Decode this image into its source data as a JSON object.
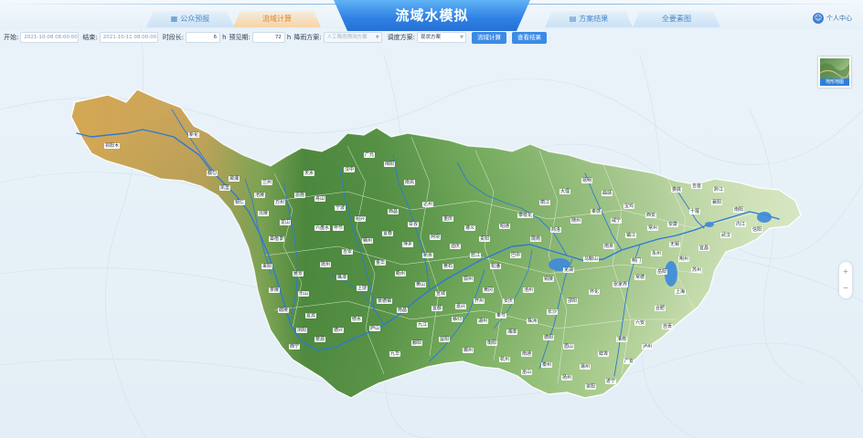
{
  "header": {
    "title": "流域水模拟",
    "tabs": [
      {
        "label": "公众预报",
        "icon": "grid-icon"
      },
      {
        "label": "流域计算",
        "icon": ""
      },
      {
        "label": "方案结果",
        "icon": "doc-icon"
      },
      {
        "label": "全要素图",
        "icon": ""
      }
    ],
    "active_tab": 1,
    "user_label": "个人中心",
    "user_icon": "user-icon"
  },
  "toolbar": {
    "start_label": "开始:",
    "start_value": "2021-10-08 08:00:00",
    "end_label": "结束:",
    "end_value": "2021-10-11 08:00:00",
    "step_label": "时段长:",
    "step_value": "6",
    "step_unit": "h",
    "lead_label": "预见期:",
    "lead_value": "72",
    "lead_unit": "h",
    "rain_label": "降雨方案:",
    "rain_select": "人工降雨预测方案",
    "sched_label": "调度方案:",
    "sched_select": "现状方案",
    "btn_compute": "流域计算",
    "btn_result": "查看结果"
  },
  "map": {
    "thumb_label": "地形地图",
    "zoom_in_icon": "plus-icon",
    "zoom_out_icon": "minus-icon",
    "labels": [
      "格尔木",
      "玉树",
      "昌都",
      "拉萨",
      "马尔康",
      "成都",
      "雅安",
      "乐山",
      "宜宾",
      "西宁",
      "兰州",
      "天水",
      "汉中",
      "广元",
      "绵阳",
      "南充",
      "达州",
      "重庆",
      "遵义",
      "贵阳",
      "昭通",
      "攀枝花",
      "丽江",
      "大理",
      "昆明",
      "曲靖",
      "宝鸡",
      "西安",
      "安康",
      "十堰",
      "襄阳",
      "南阳",
      "信阳",
      "武汉",
      "宜昌",
      "荆州",
      "岳阳",
      "常德",
      "张家界",
      "怀化",
      "邵阳",
      "长沙",
      "株洲",
      "湘潭",
      "衡阳",
      "郴州",
      "益阳",
      "九江",
      "南昌",
      "景德镇",
      "上饶",
      "鹰潭",
      "抚州",
      "吉安",
      "赣州",
      "宜春",
      "萍乡",
      "新余",
      "黄石",
      "鄂州",
      "黄冈",
      "安庆",
      "池州",
      "铜陵",
      "芜湖",
      "马鞍山",
      "南京",
      "镇江",
      "常州",
      "无锡",
      "苏州",
      "上海",
      "合肥",
      "六安",
      "淮南",
      "蚌埠",
      "滁州",
      "扬州",
      "泰州",
      "南通",
      "杭州",
      "湖州",
      "嘉兴",
      "宣城",
      "黄山",
      "衢州",
      "金华",
      "绍兴",
      "宁波",
      "舟山",
      "恩施",
      "万州",
      "涪陵",
      "铜仁",
      "凯里",
      "都匀",
      "六盘水",
      "毕节",
      "西昌",
      "甘孜",
      "阿坝",
      "迪庆",
      "怒江",
      "松潘",
      "巴中",
      "陇南",
      "商洛",
      "随州",
      "孝感",
      "咸宁",
      "荆门",
      "永州",
      "娄底",
      "吉首",
      "黔江",
      "内江",
      "自贡",
      "泸州",
      "广安",
      "遂宁",
      "资阳",
      "眉山",
      "德阳",
      "巫山",
      "奉节",
      "开州",
      "秭归",
      "宜都",
      "鄱阳",
      "九华",
      "庐山",
      "修水",
      "德兴",
      "婺源",
      "浏阳",
      "醴陵",
      "茶陵",
      "来阳",
      "祁阳",
      "新化",
      "溆浦",
      "沅陵",
      "桑植",
      "龙山"
    ]
  }
}
